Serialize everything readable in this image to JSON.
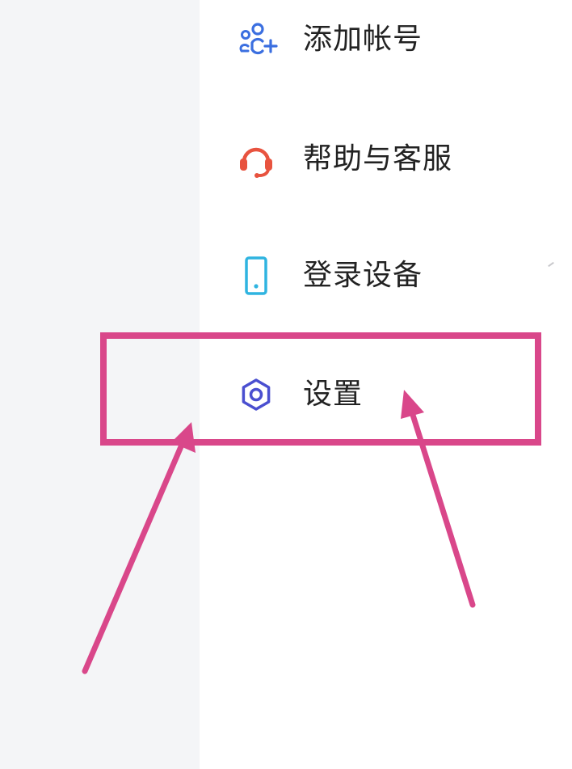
{
  "menu": {
    "items": [
      {
        "label": "添加帐号",
        "icon": "add-account-icon",
        "color": "#3b6fe0"
      },
      {
        "label": "帮助与客服",
        "icon": "headset-icon",
        "color": "#e8533f"
      },
      {
        "label": "登录设备",
        "icon": "phone-icon",
        "color": "#2fb4e0"
      },
      {
        "label": "设置",
        "icon": "gear-icon",
        "color": "#4a4fd0"
      }
    ]
  },
  "annotation": {
    "color": "#d9478a",
    "highlight_target": "设置"
  }
}
